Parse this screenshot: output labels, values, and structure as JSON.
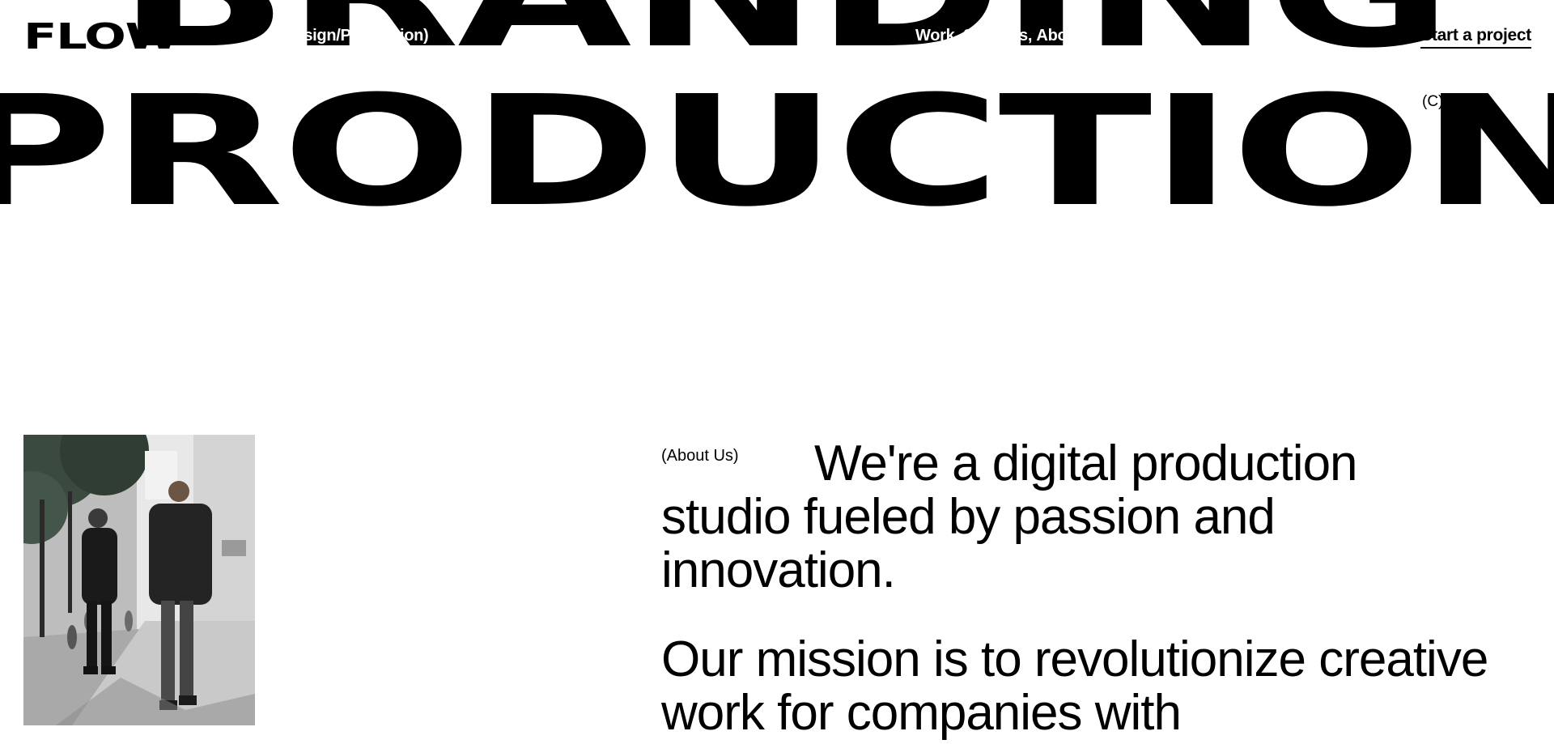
{
  "header": {
    "logo": "FLOW",
    "tagline": "(Design/Production)",
    "nav": [
      {
        "label": "Work",
        "sep": ","
      },
      {
        "label": "Services",
        "sep": ","
      },
      {
        "label": "About",
        "sep": ""
      }
    ],
    "cta": "Start a project"
  },
  "hero": {
    "line1": "BRANDING",
    "line2": "PRODUCTION",
    "mark": "(C)"
  },
  "about": {
    "label": "(About Us)",
    "paragraph1": "We're a digital production studio fueled by passion and innovation.",
    "paragraph2": "Our mission is to revolutionize creative work for companies with"
  }
}
